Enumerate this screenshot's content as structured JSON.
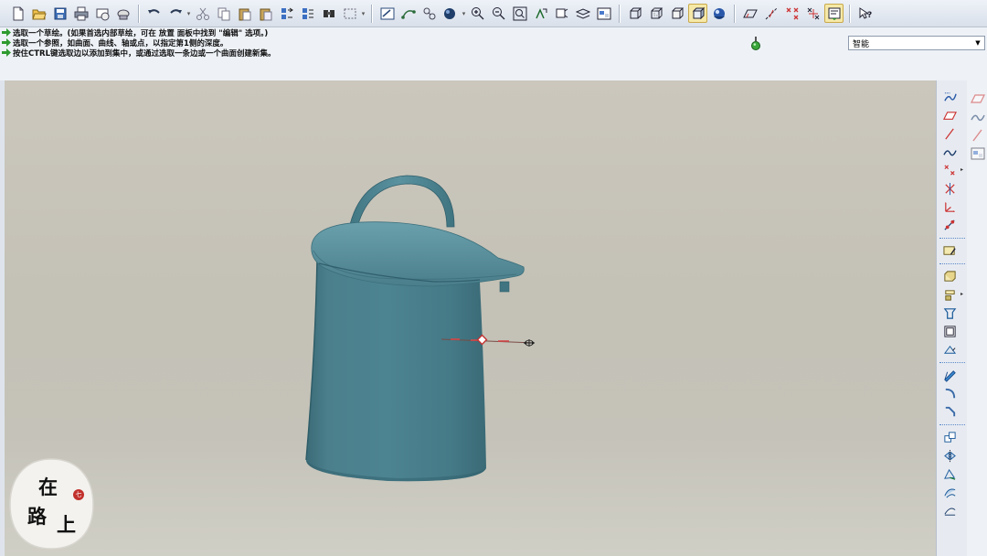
{
  "toolbar": {
    "groups": [
      [
        "new-file-icon",
        "open-folder-icon",
        "save-icon",
        "print-icon",
        "email-icon",
        "disk-icon"
      ],
      [
        "undo-icon",
        "redo-icon",
        "cut-icon",
        "copy-icon",
        "paste-icon",
        "paste-special-icon",
        "regenerate-icon",
        "regen-manager-icon",
        "find-icon",
        "select-box-icon"
      ],
      [
        "sketch-view-icon",
        "datum-display-icon",
        "model-tree-icon",
        "shading-icon",
        "zoom-in-icon",
        "zoom-out-icon",
        "refit-icon",
        "reorient-icon",
        "saved-views-icon",
        "layers-icon",
        "view-manager-icon"
      ],
      [
        "wireframe-icon",
        "hidden-line-icon",
        "no-hidden-icon",
        "shaded-icon",
        "enhanced-realism-icon"
      ],
      [
        "datum-planes-icon",
        "datum-axes-icon",
        "datum-points-icon",
        "coordinate-systems-icon",
        "annotation-display-icon"
      ],
      [
        "context-help-icon"
      ]
    ],
    "active": [
      "shaded-icon",
      "annotation-display-icon"
    ]
  },
  "messages": [
    "选取一个草绘。(如果首选内部草绘，可在 放置 面板中找到 \"编辑\" 选项。)",
    "选取一个参照，如曲面、曲线、轴或点，以指定第1侧的深度。",
    "按住CTRL键选取边以添加到集中，或通过选取一条边或一个曲面创建新集。"
  ],
  "filter": {
    "selected": "智能"
  },
  "right_toolbar": {
    "items": [
      "sketched-datum-curve-icon",
      "datum-plane-icon",
      "datum-axis-icon",
      "datum-curve-icon",
      "datum-point-icon",
      "datum-point-offset-icon",
      "datum-csys-icon",
      "analysis-icon",
      "sketch-tool-icon",
      "extrude-icon",
      "revolve-icon",
      "hole-icon",
      "shell-icon",
      "rib-icon",
      "draft-icon",
      "round-icon",
      "chamfer-icon",
      "copy-feature-icon",
      "mirror-icon",
      "pattern-icon",
      "merge-icon",
      "trim-icon"
    ]
  },
  "colors": {
    "model": "#4e8390",
    "model_dark": "#2f5f6b",
    "accent": "#c2302b"
  },
  "watermark": {
    "chars": [
      "在",
      "路",
      "上"
    ],
    "seal": "七"
  }
}
